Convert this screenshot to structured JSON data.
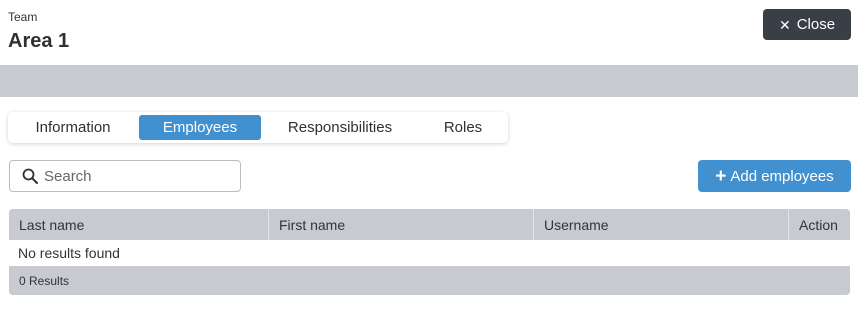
{
  "header": {
    "eyebrow": "Team",
    "title": "Area 1",
    "close_label": "Close",
    "close_icon": "close-icon"
  },
  "tabs": [
    {
      "label": "Information",
      "active": false
    },
    {
      "label": "Employees",
      "active": true
    },
    {
      "label": "Responsibilities",
      "active": false
    },
    {
      "label": "Roles",
      "active": false
    }
  ],
  "toolbar": {
    "search_placeholder": "Search",
    "search_value": "",
    "add_label": "Add employees",
    "add_icon": "plus-icon"
  },
  "table": {
    "columns": [
      "Last name",
      "First name",
      "Username",
      "Action"
    ],
    "empty_message": "No results found",
    "footer": "0 Results"
  },
  "colors": {
    "accent": "#4190cf",
    "dark_button": "#3a3f47",
    "band": "#c7cbd1"
  }
}
